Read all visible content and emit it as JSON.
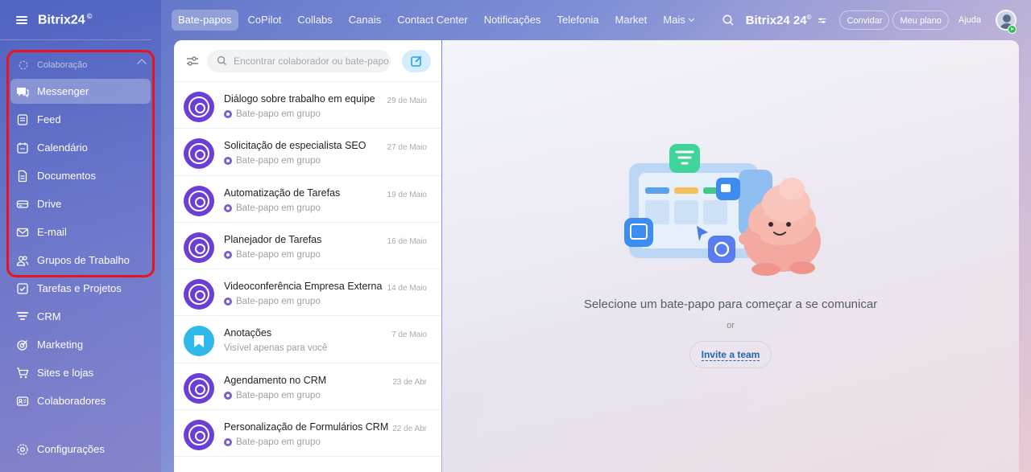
{
  "sidebar": {
    "logo": "Bitrix24",
    "logo_mark": "©",
    "group_label": "Colaboração",
    "items": [
      {
        "label": "Messenger",
        "icon": "chat-bubbles-icon",
        "active": true
      },
      {
        "label": "Feed",
        "icon": "feed-icon"
      },
      {
        "label": "Calendário",
        "icon": "calendar-icon"
      },
      {
        "label": "Documentos",
        "icon": "document-icon"
      },
      {
        "label": "Drive",
        "icon": "drive-icon"
      },
      {
        "label": "E-mail",
        "icon": "mail-icon"
      },
      {
        "label": "Grupos de Trabalho",
        "icon": "group-icon"
      },
      {
        "label": "Tarefas e Projetos",
        "icon": "task-check-icon"
      },
      {
        "label": "CRM",
        "icon": "crm-funnel-icon"
      },
      {
        "label": "Marketing",
        "icon": "marketing-target-icon"
      },
      {
        "label": "Sites e lojas",
        "icon": "cart-icon"
      },
      {
        "label": "Colaboradores",
        "icon": "id-card-icon"
      }
    ],
    "settings_label": "Configurações"
  },
  "topnav": {
    "tabs": [
      "Bate-papos",
      "CoPilot",
      "Collabs",
      "Canais",
      "Contact Center",
      "Notificações",
      "Telefonia",
      "Market",
      "Mais"
    ],
    "active_tab": "Bate-papos",
    "brand": "Bitrix24 24",
    "brand_mark": "©",
    "invite_label": "Convidar",
    "plan_label": "Meu plano",
    "help_label": "Ajuda"
  },
  "chatlist": {
    "search_placeholder": "Encontrar colaborador ou bate-papo",
    "chats": [
      {
        "title": "Diálogo sobre trabalho em equipe",
        "date": "29 de Maio",
        "subtitle": "Bate-papo em grupo",
        "type": "group"
      },
      {
        "title": "Solicitação de especialista SEO",
        "date": "27 de Maio",
        "subtitle": "Bate-papo em grupo",
        "type": "group"
      },
      {
        "title": "Automatização de Tarefas",
        "date": "19 de Maio",
        "subtitle": "Bate-papo em grupo",
        "type": "group"
      },
      {
        "title": "Planejador de Tarefas",
        "date": "16 de Maio",
        "subtitle": "Bate-papo em grupo",
        "type": "group"
      },
      {
        "title": "Videoconferência Empresa Externa",
        "date": "14 de Maio",
        "subtitle": "Bate-papo em grupo",
        "type": "group"
      },
      {
        "title": "Anotações",
        "date": "7 de Maio",
        "subtitle": "Visível apenas para você",
        "type": "notes"
      },
      {
        "title": "Agendamento no CRM",
        "date": "23 de Abr",
        "subtitle": "Bate-papo em grupo",
        "type": "group"
      },
      {
        "title": "Personalização de Formulários CRM",
        "date": "22 de Abr",
        "subtitle": "Bate-papo em grupo",
        "type": "group"
      }
    ]
  },
  "main": {
    "empty_title": "Selecione um bate-papo para começar a se comunicar",
    "or_label": "or",
    "invite_team_label": "Invite a team"
  },
  "colors": {
    "accent": "#2fb8ea",
    "group_avatar": "#6b3fd6",
    "highlight": "#e8141d"
  }
}
